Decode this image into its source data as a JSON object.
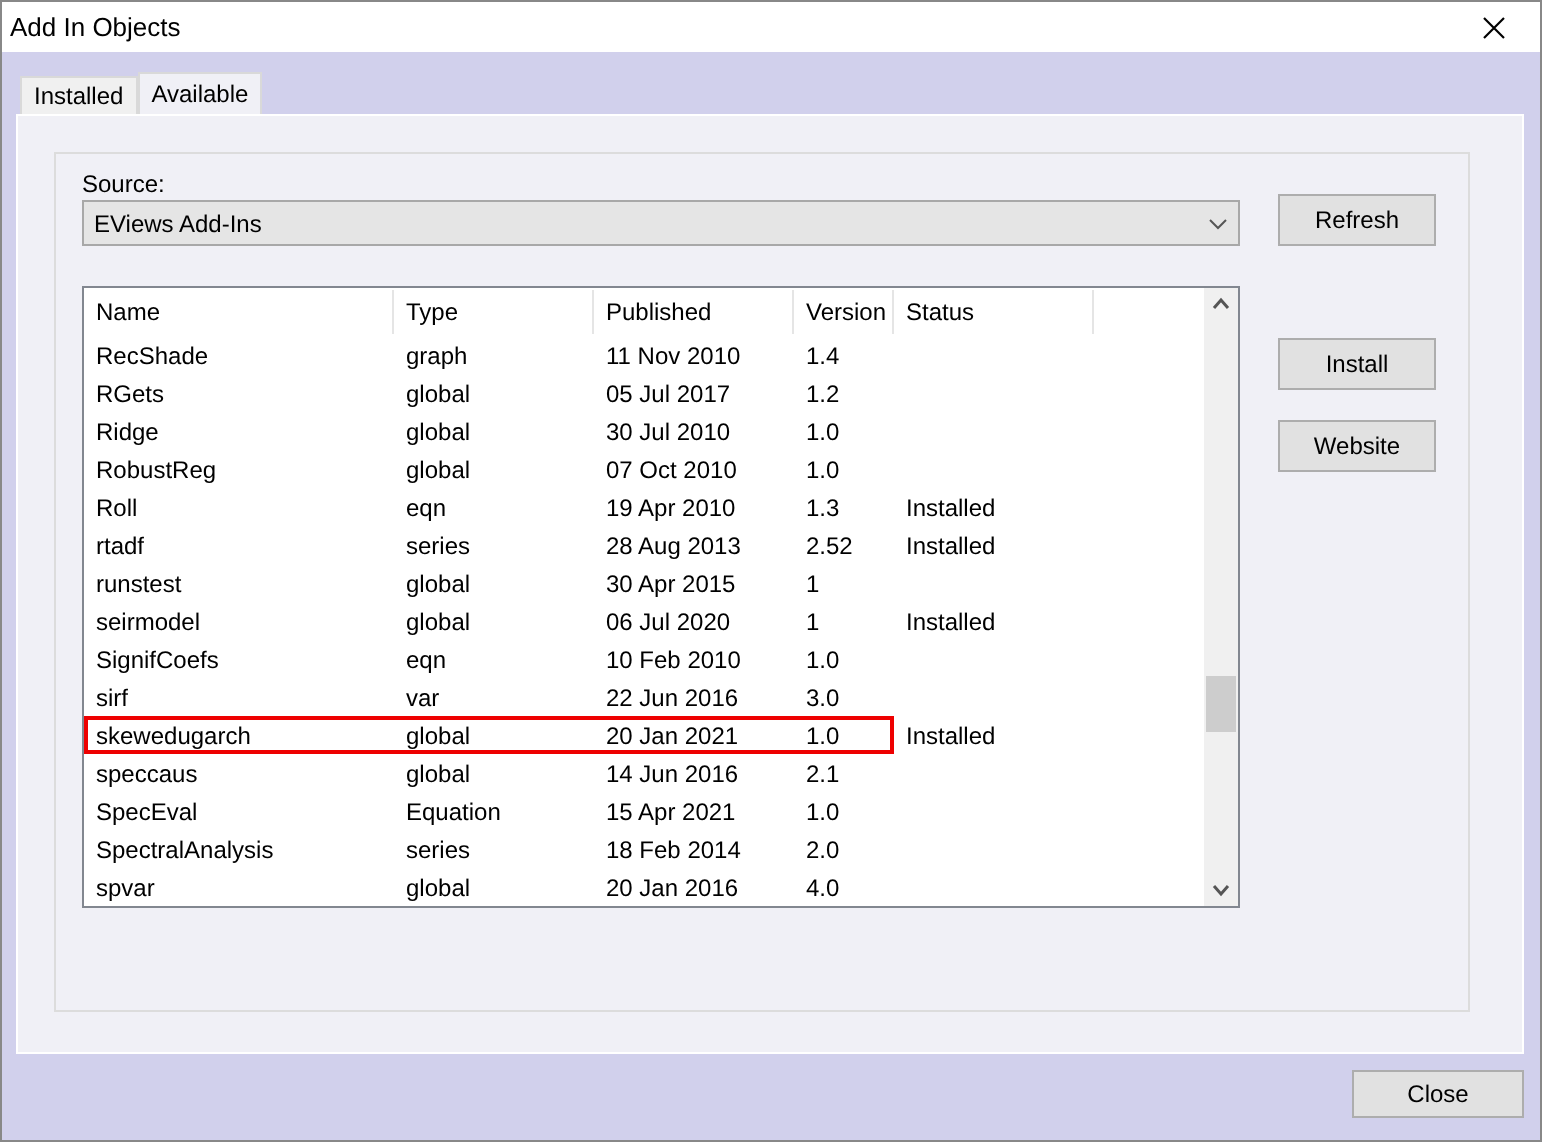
{
  "window": {
    "title": "Add In Objects"
  },
  "tabs": [
    {
      "label": "Installed",
      "selected": false
    },
    {
      "label": "Available",
      "selected": true
    }
  ],
  "source": {
    "label": "Source:",
    "value": "EViews Add-Ins"
  },
  "table": {
    "columns": [
      "Name",
      "Type",
      "Published",
      "Version",
      "Status"
    ],
    "rows": [
      {
        "cells": [
          "RecShade",
          "graph",
          "11 Nov 2010",
          "1.4",
          ""
        ],
        "highlighted": false
      },
      {
        "cells": [
          "RGets",
          "global",
          "05 Jul 2017",
          "1.2",
          ""
        ],
        "highlighted": false
      },
      {
        "cells": [
          "Ridge",
          "global",
          "30 Jul 2010",
          "1.0",
          ""
        ],
        "highlighted": false
      },
      {
        "cells": [
          "RobustReg",
          "global",
          "07 Oct 2010",
          "1.0",
          ""
        ],
        "highlighted": false
      },
      {
        "cells": [
          "Roll",
          "eqn",
          "19 Apr 2010",
          "1.3",
          "Installed"
        ],
        "highlighted": false
      },
      {
        "cells": [
          "rtadf",
          "series",
          "28 Aug 2013",
          "2.52",
          "Installed"
        ],
        "highlighted": false
      },
      {
        "cells": [
          "runstest",
          "global",
          "30 Apr 2015",
          "1",
          ""
        ],
        "highlighted": false
      },
      {
        "cells": [
          "seirmodel",
          "global",
          "06 Jul 2020",
          "1",
          "Installed"
        ],
        "highlighted": false
      },
      {
        "cells": [
          "SignifCoefs",
          "eqn",
          "10 Feb 2010",
          "1.0",
          ""
        ],
        "highlighted": false
      },
      {
        "cells": [
          "sirf",
          "var",
          "22 Jun 2016",
          "3.0",
          ""
        ],
        "highlighted": false
      },
      {
        "cells": [
          "skewedugarch",
          "global",
          "20 Jan 2021",
          "1.0",
          "Installed"
        ],
        "highlighted": true
      },
      {
        "cells": [
          "speccaus",
          "global",
          "14 Jun 2016",
          "2.1",
          ""
        ],
        "highlighted": false
      },
      {
        "cells": [
          "SpecEval",
          "Equation",
          "15 Apr 2021",
          "1.0",
          ""
        ],
        "highlighted": false
      },
      {
        "cells": [
          "SpectralAnalysis",
          "series",
          "18 Feb 2014",
          "2.0",
          ""
        ],
        "highlighted": false
      },
      {
        "cells": [
          "spvar",
          "global",
          "20 Jan 2016",
          "4.0",
          ""
        ],
        "highlighted": false
      }
    ]
  },
  "side_buttons": [
    "Refresh",
    "Install",
    "Website"
  ],
  "close_button": "Close"
}
